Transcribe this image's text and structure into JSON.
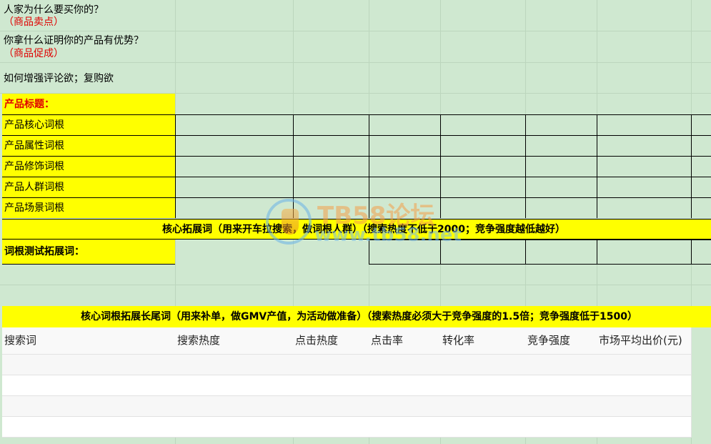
{
  "intro": {
    "q1": "人家为什么要买你的？",
    "a1": "（商品卖点）",
    "q2": "你拿什么证明你的产品有优势？",
    "a2": "（商品促成）",
    "q3": "如何增强评论欲；复购欲"
  },
  "title_label": "产品标题：",
  "root_words": [
    "产品核心词根",
    "产品属性词根",
    "产品修饰词根",
    "产品人群词根",
    "产品场景词根"
  ],
  "core_banner": "核心拓展词（用来开车拉搜索，做词根人群）（搜索热度不低于2000；竞争强度越低越好）",
  "test_label": "词根测试拓展词：",
  "longtail_banner": "核心词根拓展长尾词（用来补单，做GMV产值，为活动做准备）（搜索热度必须大于竞争强度的1.5倍；竞争强度低于1500）",
  "table": {
    "headers": [
      "搜索词",
      "搜索热度",
      "点击热度",
      "点击率",
      "转化率",
      "竞争强度",
      "市场平均出价(元)"
    ]
  },
  "watermark": {
    "title": "TB58论坛",
    "url": "www.tb58.net"
  },
  "colors": {
    "sheet_bg": "#cfe8d0",
    "highlight": "#ffff00",
    "accent_red": "#e00000"
  }
}
